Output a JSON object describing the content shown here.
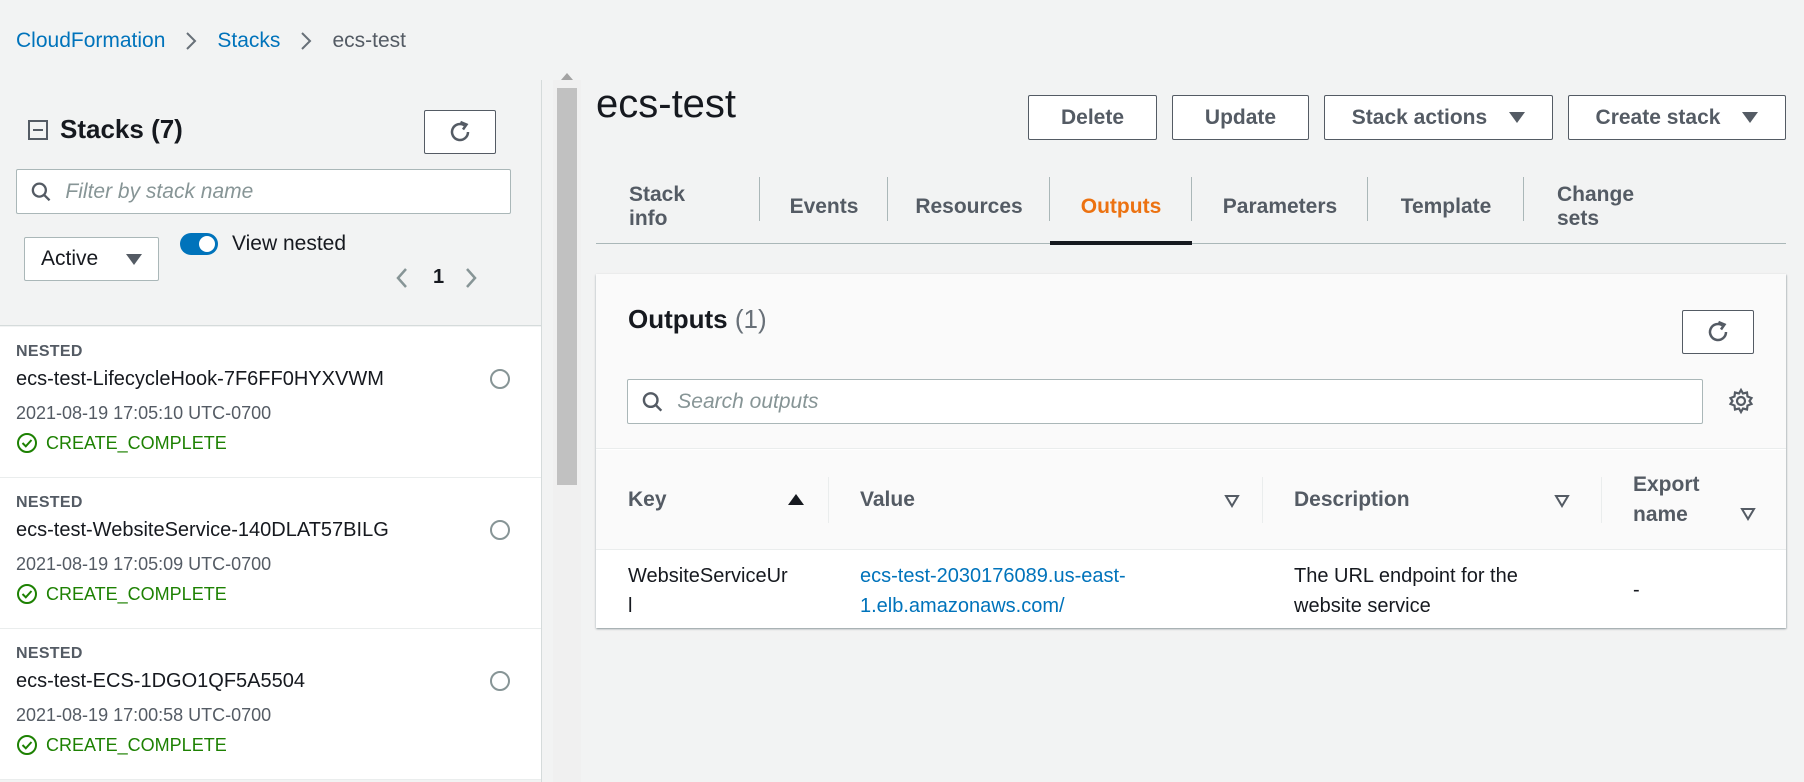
{
  "breadcrumb": {
    "items": [
      "CloudFormation",
      "Stacks"
    ],
    "current": "ecs-test"
  },
  "left_panel": {
    "title": "Stacks (7)",
    "filter_placeholder": "Filter by stack name",
    "status_filter": "Active",
    "view_nested_label": "View nested",
    "view_nested_on": true,
    "page": "1",
    "stacks": [
      {
        "tag": "NESTED",
        "name": "ecs-test-LifecycleHook-7F6FF0HYXVWM",
        "date": "2021-08-19 17:05:10 UTC-0700",
        "status": "CREATE_COMPLETE"
      },
      {
        "tag": "NESTED",
        "name": "ecs-test-WebsiteService-140DLAT57BILG",
        "date": "2021-08-19 17:05:09 UTC-0700",
        "status": "CREATE_COMPLETE"
      },
      {
        "tag": "NESTED",
        "name": "ecs-test-ECS-1DGO1QF5A5504",
        "date": "2021-08-19 17:00:58 UTC-0700",
        "status": "CREATE_COMPLETE"
      }
    ]
  },
  "main": {
    "title": "ecs-test",
    "buttons": {
      "delete": "Delete",
      "update": "Update",
      "stack_actions": "Stack actions",
      "create_stack": "Create stack"
    },
    "tabs": [
      "Stack info",
      "Events",
      "Resources",
      "Outputs",
      "Parameters",
      "Template",
      "Change sets"
    ],
    "active_tab": "Outputs",
    "outputs": {
      "title": "Outputs",
      "count": "(1)",
      "search_placeholder": "Search outputs",
      "columns": {
        "key": "Key",
        "value": "Value",
        "description": "Description",
        "export_line1": "Export",
        "export_line2": "name"
      },
      "rows": [
        {
          "key_line1": "WebsiteServiceUr",
          "key_line2": "l",
          "value_line1": "ecs-test-2030176089.us-east-",
          "value_line2": "1.elb.amazonaws.com/",
          "desc_line1": "The URL endpoint for the",
          "desc_line2": "website service",
          "export": "-"
        }
      ]
    }
  },
  "colors": {
    "link": "#0073bb",
    "active_tab": "#ec7211",
    "success": "#1d8102",
    "toggle": "#0073bb"
  },
  "icons": [
    "chevron-right-icon",
    "collapse-icon",
    "refresh-icon",
    "search-icon",
    "caret-down-icon",
    "chevron-left-icon",
    "status-success-icon",
    "settings-gear-icon",
    "sort-ascending-icon",
    "sort-icon"
  ]
}
